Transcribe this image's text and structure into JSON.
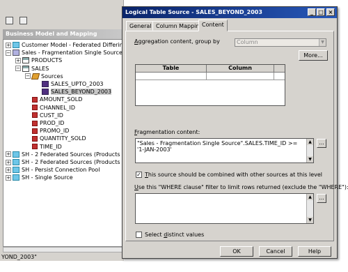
{
  "sidebar": {
    "title": "Business Model and Mapping",
    "status": "YOND_2003\"",
    "tree": [
      {
        "label": "Customer Model - Federated Differing G",
        "exp": "+",
        "icon": "folder-icon",
        "level": 0
      },
      {
        "label": "Sales - Fragmentation Single Source",
        "exp": "−",
        "icon": "model-icon",
        "level": 0
      },
      {
        "label": "PRODUCTS",
        "exp": "+",
        "icon": "table-icon",
        "level": 1
      },
      {
        "label": "SALES",
        "exp": "−",
        "icon": "table-icon",
        "level": 1
      },
      {
        "label": "Sources",
        "exp": "−",
        "icon": "sources-icon",
        "level": 2
      },
      {
        "label": "SALES_UPTO_2003",
        "exp": "",
        "icon": "logical-table-source-icon",
        "level": 3
      },
      {
        "label": "SALES_BEYOND_2003",
        "exp": "",
        "icon": "logical-table-source-icon",
        "level": 3,
        "selected": true
      },
      {
        "label": "AMOUNT_SOLD",
        "exp": "",
        "icon": "column-icon",
        "level": 2
      },
      {
        "label": "CHANNEL_ID",
        "exp": "",
        "icon": "column-icon",
        "level": 2
      },
      {
        "label": "CUST_ID",
        "exp": "",
        "icon": "column-icon",
        "level": 2
      },
      {
        "label": "PROD_ID",
        "exp": "",
        "icon": "column-icon",
        "level": 2
      },
      {
        "label": "PROMO_ID",
        "exp": "",
        "icon": "column-icon",
        "level": 2
      },
      {
        "label": "QUANTITY_SOLD",
        "exp": "",
        "icon": "column-icon",
        "level": 2
      },
      {
        "label": "TIME_ID",
        "exp": "",
        "icon": "column-icon",
        "level": 2
      },
      {
        "label": "SH - 2 Federated Sources (Products Fe",
        "exp": "+",
        "icon": "folder-icon",
        "level": 0
      },
      {
        "label": "SH - 2 Federated Sources (Products O",
        "exp": "+",
        "icon": "folder-icon",
        "level": 0
      },
      {
        "label": "SH - Persist Connection Pool",
        "exp": "+",
        "icon": "folder-icon",
        "level": 0
      },
      {
        "label": "SH - Single Source",
        "exp": "+",
        "icon": "folder-icon",
        "level": 0
      }
    ]
  },
  "dialog": {
    "title": "Logical Table Source - SALES_BEYOND_2003",
    "window_buttons": {
      "min": "_",
      "max": "□",
      "close": "×"
    },
    "tabs": [
      "General",
      "Column Mapping",
      "Content"
    ],
    "active_tab": 2,
    "aggregation_label_pre": "",
    "aggregation_label_u": "A",
    "aggregation_label_post": "ggregation content, group by",
    "aggregation_value": "Column",
    "more_button": "More...",
    "grid_headers": [
      "Table",
      "Column"
    ],
    "fragmentation_label_pre": "",
    "fragmentation_label_u": "F",
    "fragmentation_label_post": "ragmentation content:",
    "fragmentation_text_line1": "\"Sales - Fragmentation Single Source\".SALES.TIME_ID >=",
    "fragmentation_text_line2": "'1-JAN-2003'",
    "ellipsis": "...",
    "combine_checked": true,
    "combine_label_pre": "",
    "combine_label_u": "T",
    "combine_label_post": "his source should be combined with other sources at this level",
    "where_label_pre": "",
    "where_label_u": "U",
    "where_label_post": "se this \"WHERE clause\" filter to limit rows returned (exclude the \"WHERE\"):",
    "distinct_checked": false,
    "distinct_label_pre": "Select ",
    "distinct_label_u": "d",
    "distinct_label_post": "istinct values",
    "ok_button": "OK",
    "cancel_button": "Cancel",
    "help_button": "Help"
  }
}
